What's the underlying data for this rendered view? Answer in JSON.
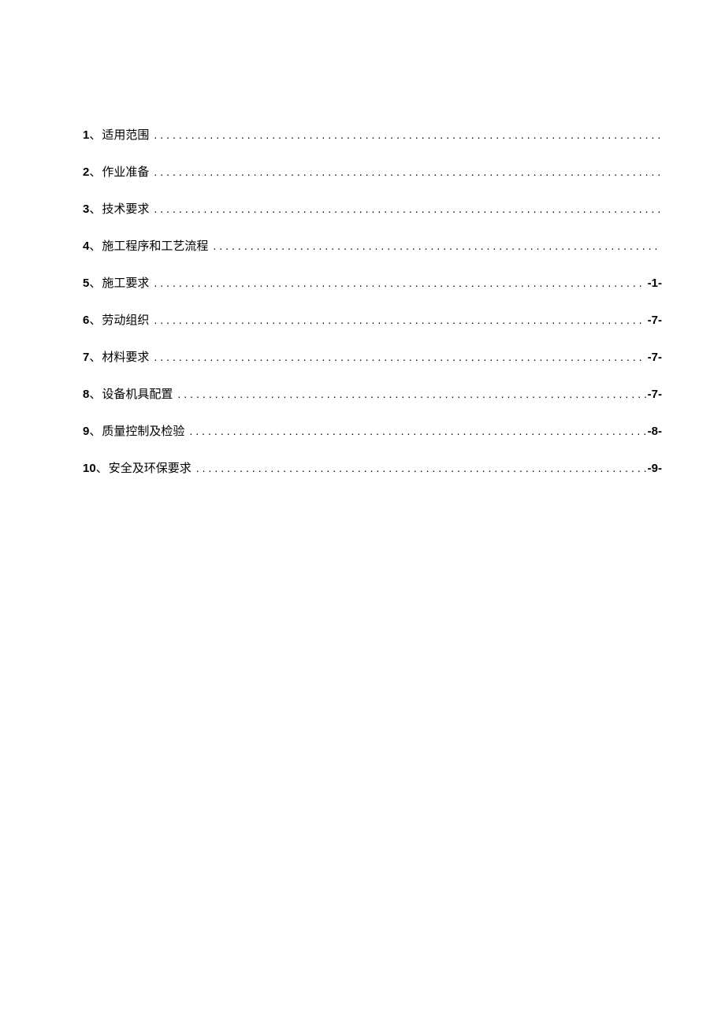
{
  "toc": [
    {
      "num": "1",
      "sep": "、",
      "title": "适用范围",
      "page": ""
    },
    {
      "num": "2",
      "sep": "、",
      "title": "作业准备",
      "page": ""
    },
    {
      "num": "3",
      "sep": "、",
      "title": "技术要求",
      "page": ""
    },
    {
      "num": "4",
      "sep": "、",
      "title": "施工程序和工艺流程",
      "page": ""
    },
    {
      "num": "5",
      "sep": "、",
      "title": "施工要求",
      "page": "-1-"
    },
    {
      "num": "6",
      "sep": "、",
      "title": "劳动组织",
      "page": "-7-"
    },
    {
      "num": "7",
      "sep": "、",
      "title": "材料要求",
      "page": "-7-"
    },
    {
      "num": "8",
      "sep": "、",
      "title": "设备机具配置",
      "page": "-7-"
    },
    {
      "num": "9",
      "sep": "、",
      "title": "质量控制及检验",
      "page": "-8-"
    },
    {
      "num": "10",
      "sep": "、",
      "title": "安全及环保要求",
      "page": "-9-"
    }
  ]
}
